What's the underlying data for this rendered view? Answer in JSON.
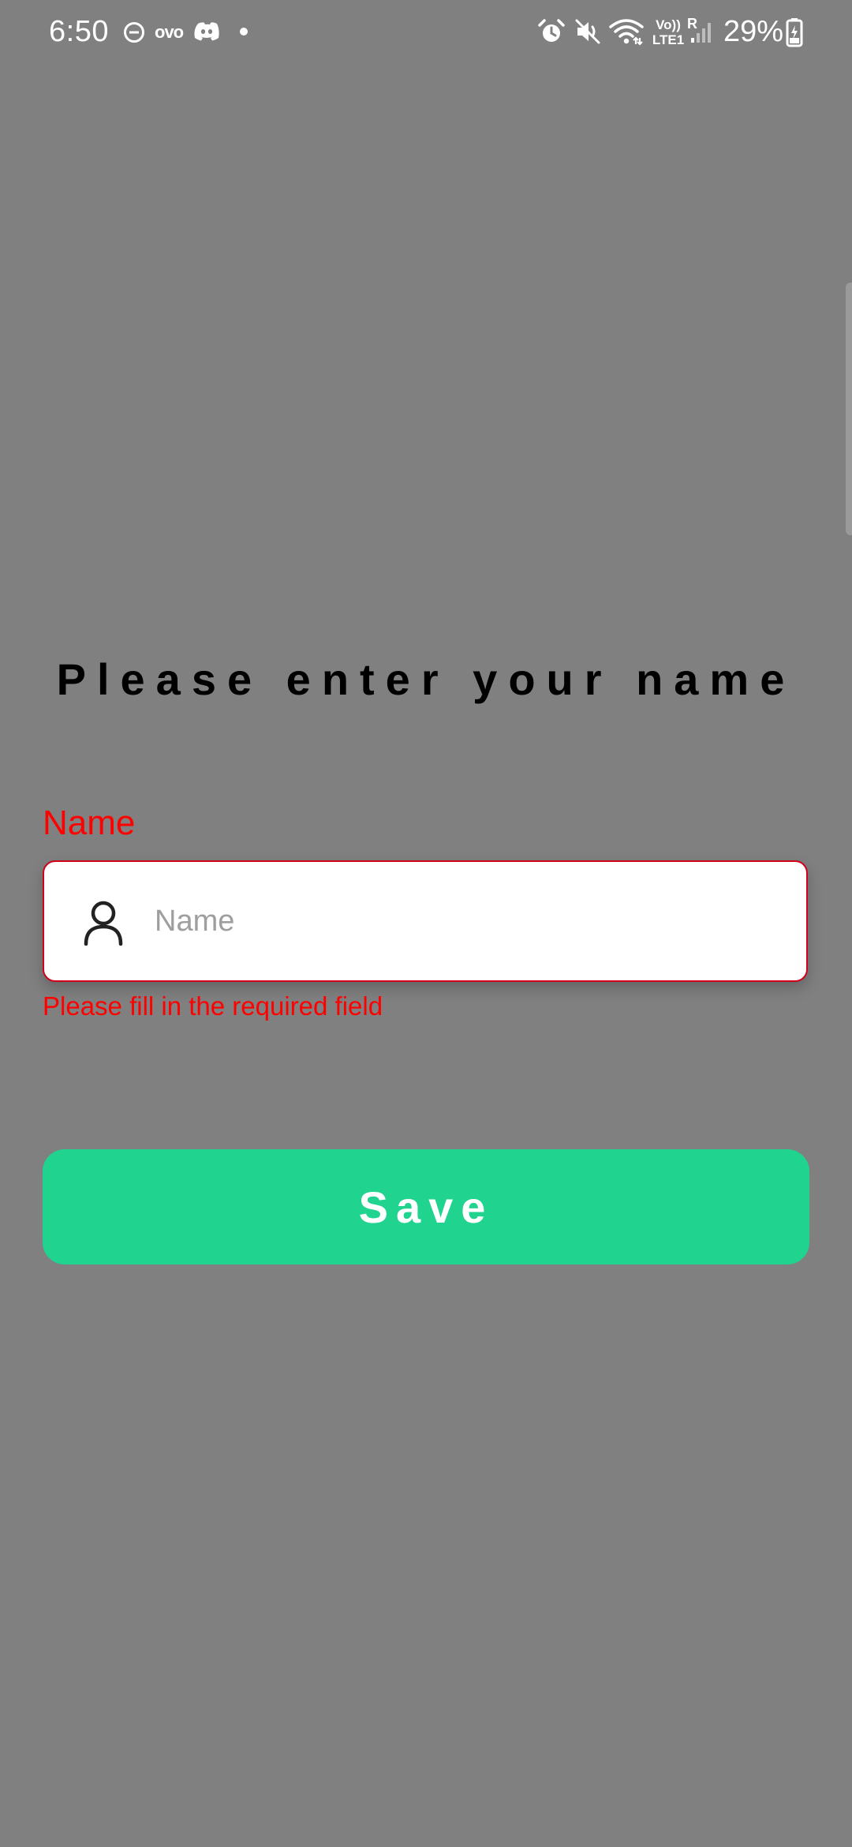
{
  "status_bar": {
    "time": "6:50",
    "notification_icons": [
      "do-not-disturb-icon",
      "ovo-icon",
      "discord-icon",
      "dot-icon"
    ],
    "ovo_text": "ovo",
    "system_icons": [
      "alarm-icon",
      "mute-icon",
      "wifi-icon",
      "volte-icon",
      "signal-icon",
      "battery-icon"
    ],
    "volte_top": "Vo))",
    "volte_bottom": "LTE1",
    "roaming": "R",
    "battery_percent": "29%"
  },
  "form": {
    "title": "Please enter your name",
    "field_label": "Name",
    "name_input": {
      "value": "",
      "placeholder": "Name",
      "icon": "person-icon"
    },
    "error_message": "Please fill in the required field"
  },
  "actions": {
    "save_label": "Save"
  },
  "colors": {
    "background": "#808080",
    "error": "#ff0000",
    "save_button": "#20d38f",
    "input_border": "#d0021b"
  }
}
